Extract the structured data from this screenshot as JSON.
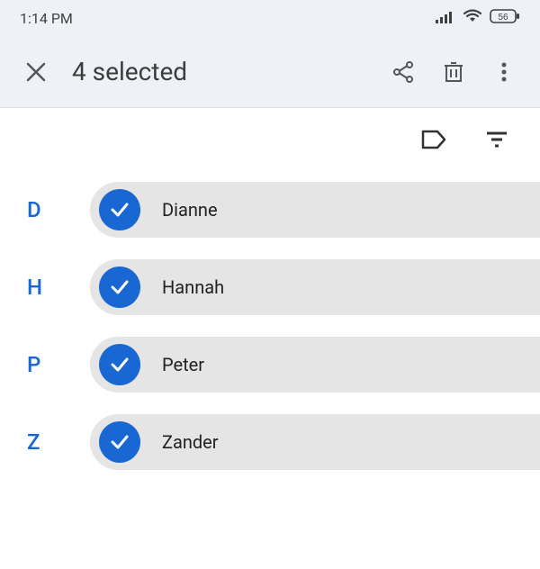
{
  "status": {
    "time": "1:14 PM",
    "battery": "56"
  },
  "header": {
    "title": "4 selected"
  },
  "contacts": [
    {
      "letter": "D",
      "name": "Dianne"
    },
    {
      "letter": "H",
      "name": "Hannah"
    },
    {
      "letter": "P",
      "name": "Peter"
    },
    {
      "letter": "Z",
      "name": "Zander"
    }
  ]
}
